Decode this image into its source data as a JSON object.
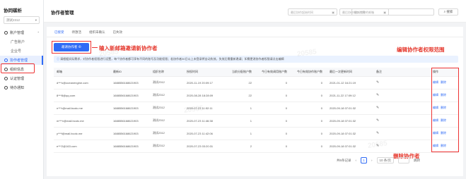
{
  "sidebar": {
    "logo": "协同碳析",
    "org_select": "测试2312",
    "items": [
      {
        "label": "账户管理",
        "sub": false,
        "caret": "⌃"
      },
      {
        "label": "广告账户",
        "sub": true
      },
      {
        "label": "企业号",
        "sub": true
      },
      {
        "label": "协作者管理",
        "sub": false,
        "active": true
      },
      {
        "label": "组织信息",
        "sub": false
      },
      {
        "label": "认证管理",
        "sub": false
      },
      {
        "label": "待办通知",
        "sub": false
      }
    ]
  },
  "header": {
    "title": "协作者管理",
    "start_date_placeholder": "最后协作起始时间",
    "end_date_placeholder": "最后协作结束时间",
    "search_placeholder": "输入完整的邮箱",
    "search_button": "搜索"
  },
  "tabs": [
    {
      "label": "已接受",
      "active": true
    },
    {
      "label": "待激活"
    },
    {
      "label": "组织未确认"
    },
    {
      "label": "已失效"
    }
  ],
  "invite_button": "邀请协作者",
  "annotations": {
    "invite": "输入新邮箱邀请新协作者",
    "edit_permissions": "编辑协作者权限范围",
    "delete": "删除协作者"
  },
  "notice": "请根据实际需求，对协作者权限进行设置，每个协作者都可享有不同的账号及功能权限；若协作者30日以上未登录将自动失效，失效后需重新邀请；如需更改协作者权限请点击编辑",
  "table": {
    "columns": [
      "邮箱",
      "最新ID",
      "组织名称",
      "授权时间",
      "当前分配账户数",
      "今日有效调用账户数",
      "今日有效协作账户数",
      "最后一次更新时间",
      "备注",
      "操作"
    ],
    "rows": [
      {
        "email": "d***o@oceanengine.com",
        "id": "1688556168621903",
        "org": "测试2312",
        "auth_time": "2020-11-19 20:09:17",
        "accounts": "22",
        "daily_calls": "0",
        "daily_collab": "0",
        "updated": "2021-01-12 16:21:19"
      },
      {
        "email": "8***8@qq.com",
        "id": "1688556168621903",
        "org": "测试2312",
        "auth_time": "2020-08-28 18:28:09",
        "accounts": "22",
        "daily_calls": "0",
        "daily_collab": "0",
        "updated": "2021-11-22 17:09:12"
      },
      {
        "email": "n***r@mail.bcotc.me",
        "id": "1688556168621903",
        "org": "测试2312",
        "auth_time": "2020-07-23 11:52:11",
        "accounts": "1",
        "daily_calls": "0",
        "daily_collab": "0",
        "updated": "2020-09-18 07:01:32"
      },
      {
        "email": "m***v@mail.bcotc.me",
        "id": "1688556168621903",
        "org": "测试2312",
        "auth_time": "2020-07-23 11:46:38",
        "accounts": "1",
        "daily_calls": "0",
        "daily_collab": "0",
        "updated": "2020-09-18 07:01:32"
      },
      {
        "email": "y***f@mail.bcotc.me",
        "id": "1688556168621903",
        "org": "测试2312",
        "auth_time": "2020-07-23 11:42:06",
        "accounts": "1",
        "daily_calls": "0",
        "daily_collab": "0",
        "updated": "2020-09-18 07:01:32"
      },
      {
        "email": "e***2@163.com",
        "id": "1688556168621903",
        "org": "测试2312",
        "auth_time": "2020-07-23 03:20:31",
        "accounts": "2",
        "daily_calls": "0",
        "daily_collab": "0",
        "updated": "2020-09-18 07:01:32"
      }
    ],
    "edit_label": "编辑",
    "delete_label": "删除"
  },
  "pager": {
    "total": "共6条记录",
    "page": "1",
    "page_size": "10 条/页",
    "jump": "跳转"
  },
  "colors": {
    "accent": "#2f6bf6",
    "annotation": "#e5382d"
  }
}
